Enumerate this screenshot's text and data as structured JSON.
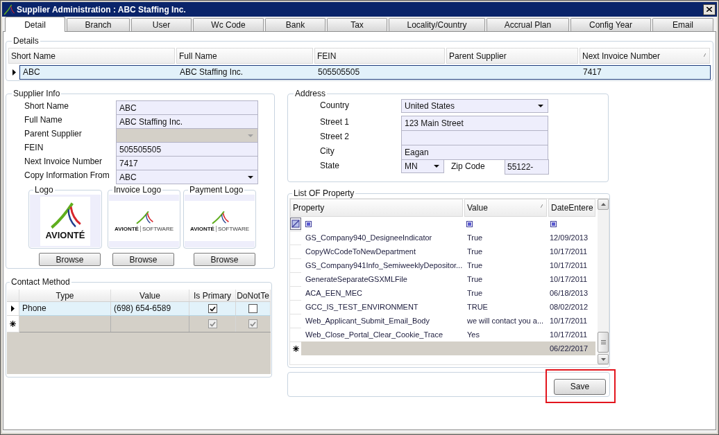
{
  "window": {
    "title": "Supplier Administration : ABC Staffing Inc."
  },
  "tabs": [
    {
      "label": "Detail",
      "selected": true
    },
    {
      "label": "Branch",
      "selected": false
    },
    {
      "label": "User",
      "selected": false
    },
    {
      "label": "Wc Code",
      "selected": false
    },
    {
      "label": "Bank",
      "selected": false
    },
    {
      "label": "Tax",
      "selected": false
    },
    {
      "label": "Locality/Country",
      "selected": false
    },
    {
      "label": "Accrual Plan",
      "selected": false
    },
    {
      "label": "Config Year",
      "selected": false
    },
    {
      "label": "Email",
      "selected": false
    }
  ],
  "details": {
    "title": "Details",
    "columns": [
      {
        "label": "Short Name",
        "sorted": false
      },
      {
        "label": "Full Name",
        "sorted": false
      },
      {
        "label": "FEIN",
        "sorted": false
      },
      {
        "label": "Parent Supplier",
        "sorted": false
      },
      {
        "label": "Next Invoice Number",
        "sorted": true
      }
    ],
    "rows": [
      {
        "selected": true,
        "short_name": "ABC",
        "full_name": "ABC Staffing Inc.",
        "fein": "505505505",
        "next_invoice_number": "7417"
      }
    ]
  },
  "supplier_info": {
    "title": "Supplier Info",
    "fields": [
      {
        "kind": "text",
        "label": "Short Name",
        "value": "ABC",
        "disabled": false
      },
      {
        "kind": "text",
        "label": "Full Name",
        "value": "ABC Staffing Inc.",
        "disabled": false
      },
      {
        "kind": "combo",
        "label": "Parent Supplier",
        "disabled": true
      },
      {
        "kind": "text",
        "label": "FEIN",
        "value": "505505505",
        "disabled": false
      },
      {
        "kind": "text",
        "label": "Next Invoice Number",
        "value": "7417",
        "disabled": false
      },
      {
        "kind": "combo",
        "label": "Copy Information From",
        "value": "ABC",
        "disabled": false
      }
    ],
    "logos": [
      {
        "label": "Logo",
        "kind": "large",
        "wordmark": "AVIONTÉ",
        "button": "Browse"
      },
      {
        "label": "Invoice Logo",
        "kind": "small",
        "wordmark": "AVIONTÉ",
        "tagline": "SOFTWARE",
        "button": "Browse"
      },
      {
        "label": "Payment Logo",
        "kind": "small",
        "wordmark": "AVIONTÉ",
        "tagline": "SOFTWARE",
        "button": "Browse"
      }
    ]
  },
  "contact_method": {
    "title": "Contact Method",
    "columns": [
      {
        "label": "Type"
      },
      {
        "label": "Value"
      },
      {
        "label": "Is Primary"
      },
      {
        "label": "DoNotTe"
      }
    ],
    "rows": [
      {
        "kind": "data",
        "selected": true,
        "type": "Phone",
        "value": "(698) 654-6589",
        "is_primary": true,
        "column_4": false
      },
      {
        "kind": "new",
        "selected": false,
        "is_primary": true,
        "column_4": true
      }
    ]
  },
  "address": {
    "title": "Address",
    "fields": [
      {
        "kind": "combo",
        "label": "Country",
        "value": "United States"
      },
      {
        "kind": "text",
        "label": "Street 1",
        "value": "123 Main Street"
      },
      {
        "kind": "text",
        "label": "Street 2"
      },
      {
        "kind": "text",
        "label": "City",
        "value": "Eagan"
      },
      {
        "kind": "combo",
        "label": "State",
        "value": "MN",
        "zip": {
          "label": "Zip Code",
          "value": "55122-"
        }
      }
    ]
  },
  "property_list": {
    "title": "List OF Property",
    "columns": [
      {
        "label": "Property",
        "sorted": false
      },
      {
        "label": "Value",
        "sorted": true
      },
      {
        "label": "DateEntere",
        "sorted": false
      }
    ],
    "rows": [
      {
        "kind": "data",
        "property": "GS_Company940_DesigneeIndicator",
        "value": "True",
        "column_3": "12/09/2013"
      },
      {
        "kind": "data",
        "property": "CopyWcCodeToNewDepartment",
        "value": "True",
        "column_3": "10/17/2011"
      },
      {
        "kind": "data",
        "property": "GS_Company941Info_SemiweeklyDepositor...",
        "value": "True",
        "column_3": "10/17/2011"
      },
      {
        "kind": "data",
        "property": "GenerateSeparateGSXMLFile",
        "value": "True",
        "column_3": "10/17/2011"
      },
      {
        "kind": "data",
        "property": "ACA_EEN_MEC",
        "value": "True",
        "column_3": "06/18/2013"
      },
      {
        "kind": "data",
        "property": "GCC_IS_TEST_ENVIRONMENT",
        "value": "TRUE",
        "column_3": "08/02/2012"
      },
      {
        "kind": "data",
        "property": "Web_Applicant_Submit_Email_Body",
        "value": "we will contact you a...",
        "column_3": "10/17/2011"
      },
      {
        "kind": "data",
        "property": "Web_Close_Portal_Clear_Cookie_Trace",
        "value": "Yes",
        "column_3": "10/17/2011"
      },
      {
        "kind": "new",
        "column_3": "06/22/2017"
      }
    ]
  },
  "buttons": [
    {
      "label": "Save",
      "highlighted": true
    }
  ]
}
